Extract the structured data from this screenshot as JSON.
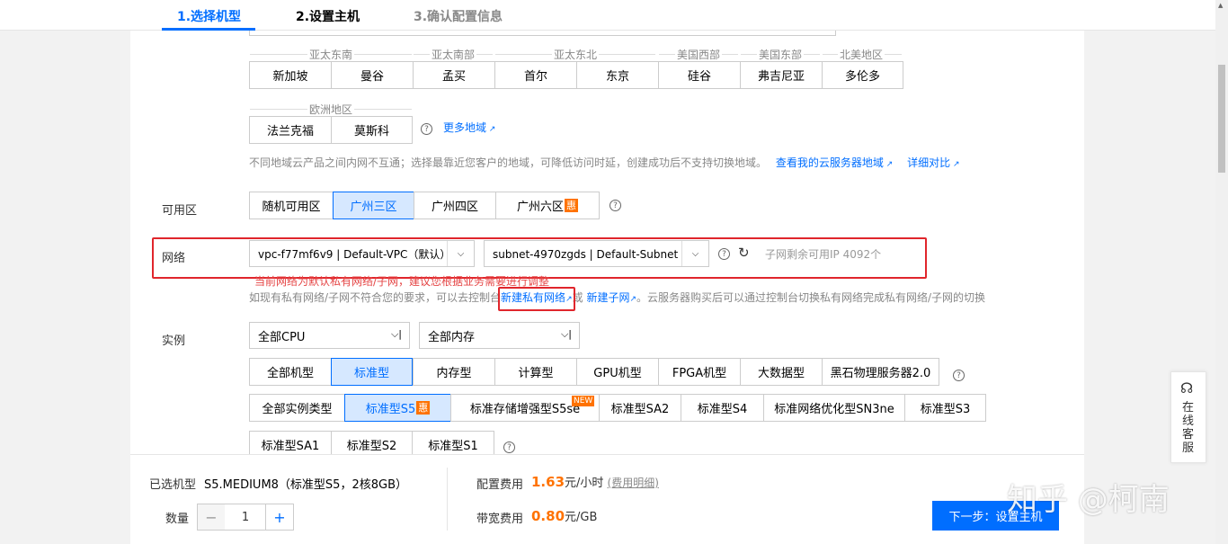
{
  "steps": [
    {
      "label": "1.选择机型"
    },
    {
      "label": "2.设置主机"
    },
    {
      "label": "3.确认配置信息"
    }
  ],
  "region": {
    "groups": [
      {
        "name": "亚太东南"
      },
      {
        "name": "亚太南部"
      },
      {
        "name": "亚太东北"
      },
      {
        "name": "美国西部"
      },
      {
        "name": "美国东部"
      },
      {
        "name": "北美地区"
      },
      {
        "name": "欧洲地区"
      }
    ],
    "buttons": [
      "新加坡",
      "曼谷",
      "孟买",
      "首尔",
      "东京",
      "硅谷",
      "弗吉尼亚",
      "多伦多",
      "法兰克福",
      "莫斯科"
    ],
    "more_link": "更多地域",
    "hint": "不同地域云产品之间内网不互通；选择最靠近您客户的地域，可降低访问时延，创建成功后不支持切换地域。",
    "view_my_region_link": "查看我的云服务器地域",
    "compare_link": "详细对比"
  },
  "zone": {
    "label": "可用区",
    "options": [
      "随机可用区",
      "广州三区",
      "广州四区",
      "广州六区"
    ],
    "selected": "广州三区",
    "hui_badge": "惠"
  },
  "network": {
    "label": "网络",
    "vpc_value": "vpc-f77mf6v9 | Default-VPC（默认）",
    "subnet_value": "subnet-4970zgds | Default-Subnet（",
    "remaining_ip": "子网剩余可用IP 4092个",
    "warning": "当前网络为默认私有网络/子网，建议您根据业务需要进行调整",
    "tip_prefix": "如现有私有网络/子网不符合您的要求，可以去控制台",
    "new_vpc_link": "新建私有网络",
    "or_text": "或",
    "new_subnet_link": "新建子网",
    "tip_suffix": "。云服务器购买后可以通过控制台切换私有网络完成私有网络/子网的切换"
  },
  "instance": {
    "label": "实例",
    "cpu_select": "全部CPU",
    "mem_select": "全部内存",
    "families": [
      "全部机型",
      "标准型",
      "内存型",
      "计算型",
      "GPU机型",
      "FPGA机型",
      "大数据型",
      "黑石物理服务器2.0"
    ],
    "selected_family": "标准型",
    "types_row1": [
      "全部实例类型",
      "标准型S5",
      "标准存储增强型S5se",
      "标准型SA2",
      "标准型S4",
      "标准网络优化型SN3ne",
      "标准型S3"
    ],
    "types_row2": [
      "标准型SA1",
      "标准型S2",
      "标准型S1"
    ],
    "selected_type": "标准型S5",
    "new_badge": "NEW",
    "hui_badge": "惠"
  },
  "footer": {
    "selected_label": "已选机型",
    "selected_value": "S5.MEDIUM8（标准型S5，2核8GB）",
    "qty_label": "数量",
    "qty_value": "1",
    "minus": "−",
    "plus": "+",
    "config_fee_label": "配置费用",
    "config_fee_value": "1.63",
    "config_fee_unit": "元/小时",
    "fee_detail_link": "(费用明细)",
    "bandwidth_fee_label": "带宽费用",
    "bandwidth_fee_value": "0.80",
    "bandwidth_fee_unit": "元/GB",
    "next_button": "下一步：设置主机"
  },
  "side_service": {
    "label": "在线客服",
    "icon": "headset-icon"
  },
  "watermark": "知乎 @柯南",
  "colors": {
    "accent": "#006eff",
    "price": "#ff7200",
    "warning": "#e54545",
    "highlight_box": "#e0262c"
  }
}
